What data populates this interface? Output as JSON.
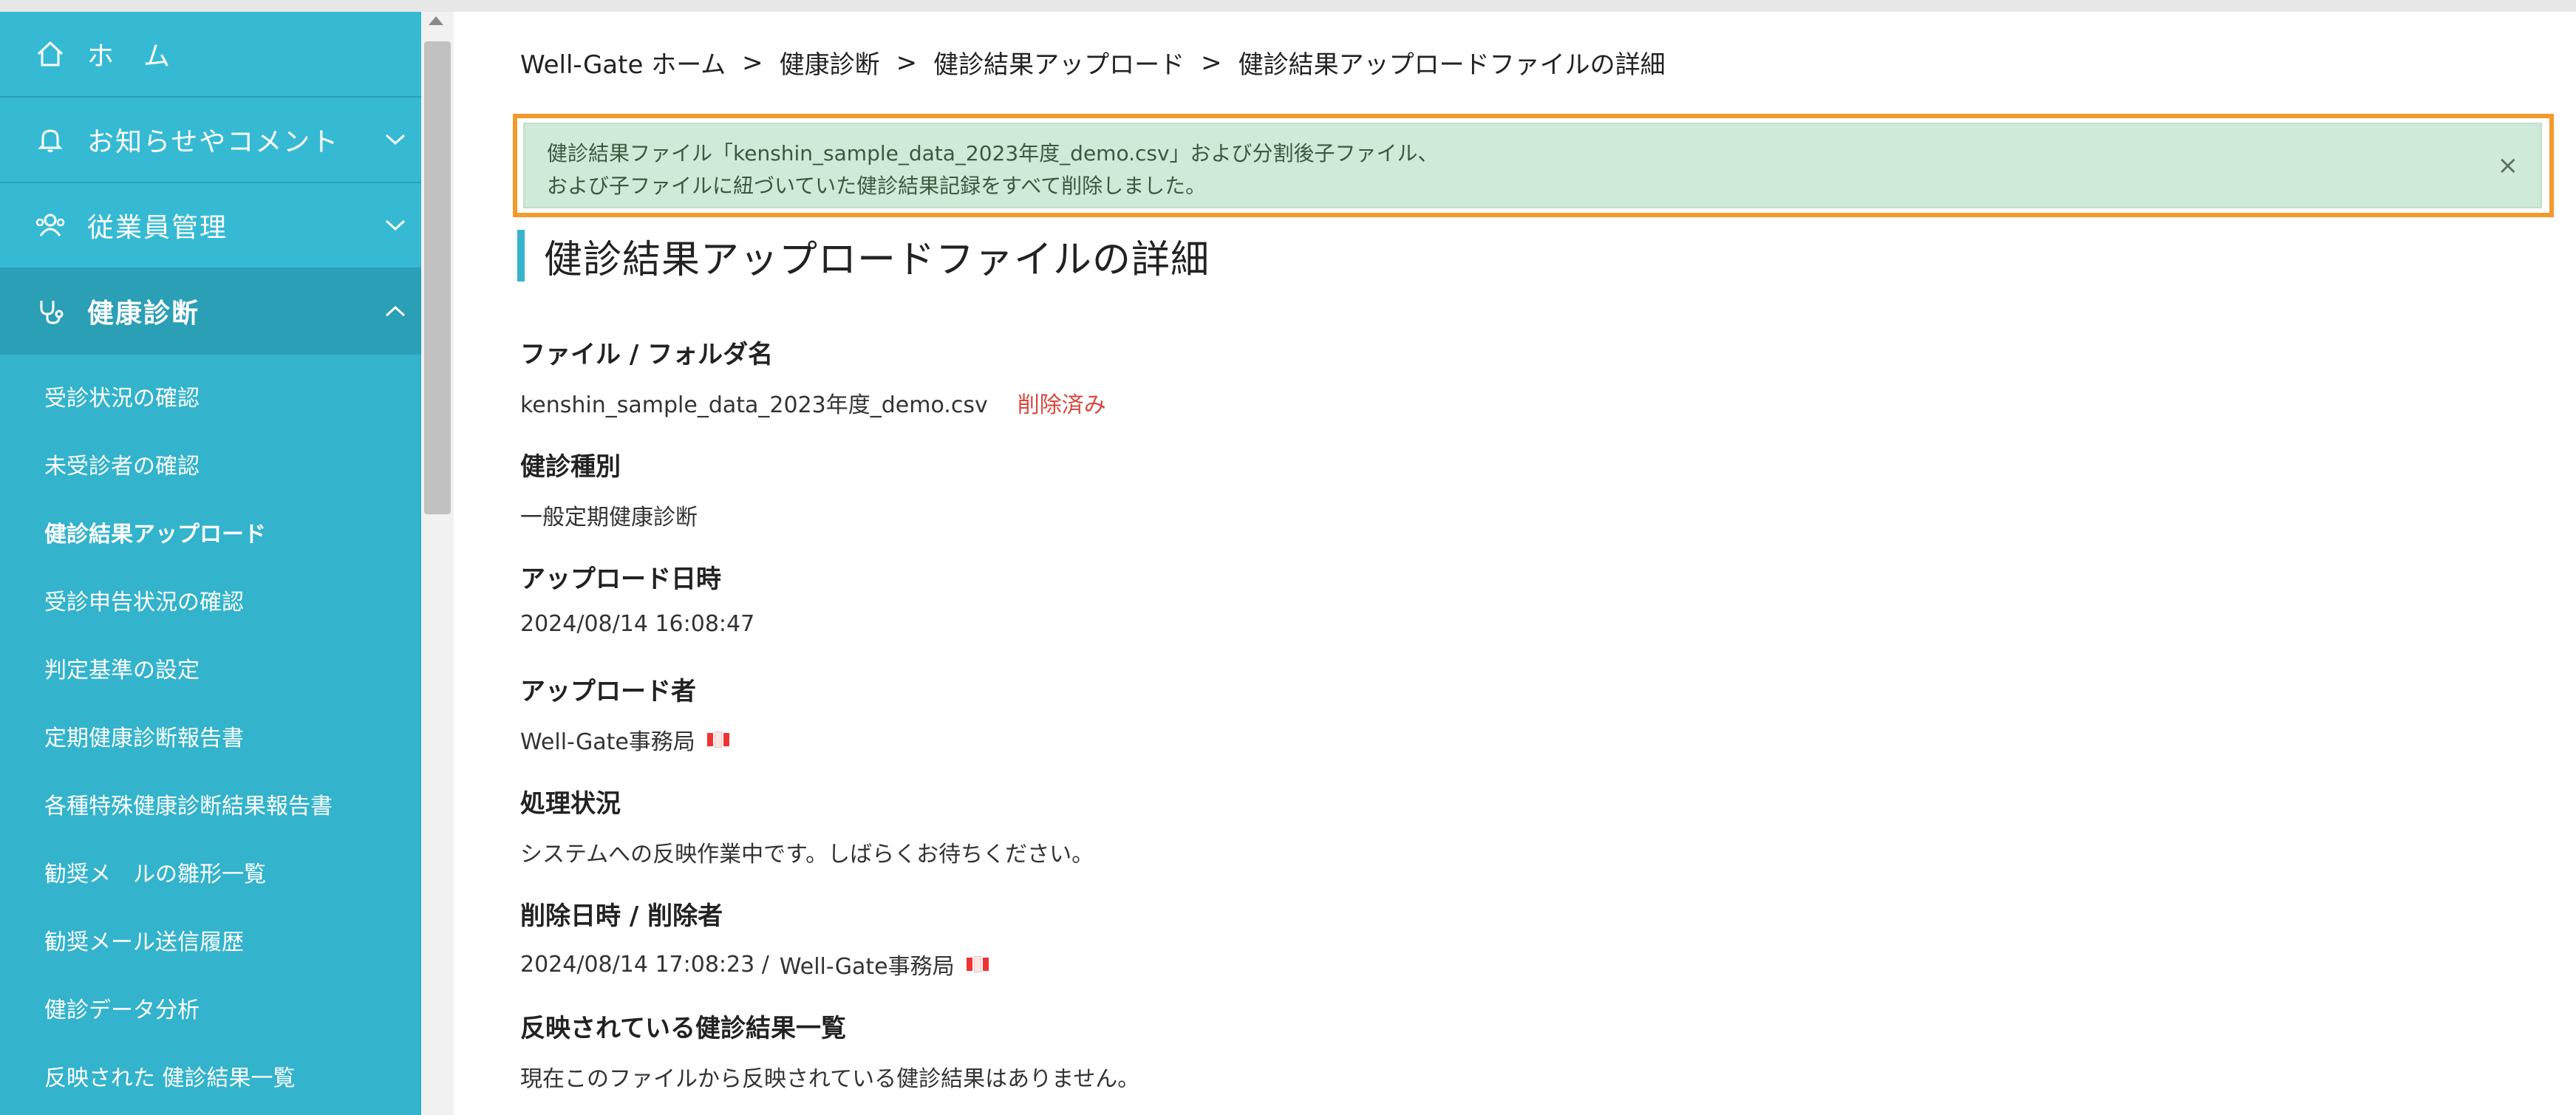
{
  "sidebar": {
    "top_items": [
      {
        "label": "ホ　ム",
        "icon": "home-icon"
      },
      {
        "label": "お知らせやコメント",
        "icon": "bell-icon"
      },
      {
        "label": "従業員管理",
        "icon": "users-icon"
      },
      {
        "label": "健康診断",
        "icon": "stethoscope-icon"
      }
    ],
    "sub_items": [
      "受診状況の確認",
      "未受診者の確認",
      "健診結果アップロード",
      "受診申告状況の確認",
      "判定基準の設定",
      "定期健康診断報告書",
      "各種特殊健康診断結果報告書",
      "勧奨メ　ルの雛形一覧",
      "勧奨メール送信履歴",
      "健診データ分析",
      "反映された 健診結果一覧"
    ],
    "current_sub_item": "健診結果アップロード"
  },
  "breadcrumb": [
    "Well-Gate ホーム",
    "健康診断",
    "健診結果アップロード",
    "健診結果アップロードファイルの詳細"
  ],
  "breadcrumb_separator": ">",
  "alert": {
    "line1": "健診結果ファイル「kenshin_sample_data_2023年度_demo.csv」および分割後子ファイル、",
    "line2": "および子ファイルに紐づいていた健診結果記録をすべて削除しました。",
    "close": "×"
  },
  "page_title": "健診結果アップロードファイルの詳細",
  "fields": {
    "file_name": {
      "label": "ファイル / フォルダ名",
      "value": "kenshin_sample_data_2023年度_demo.csv",
      "status": "削除済み"
    },
    "exam_type": {
      "label": "健診種別",
      "value": "一般定期健康診断"
    },
    "upload_datetime": {
      "label": "アップロード日時",
      "value": "2024/08/14 16:08:47"
    },
    "uploader": {
      "label": "アップロード者",
      "value": "Well-Gate事務局"
    },
    "processing_status": {
      "label": "処理状況",
      "value": "システムへの反映作業中です。しばらくお待ちください。"
    },
    "deletion": {
      "label": "削除日時 / 削除者",
      "datetime": "2024/08/14 17:08:23 /",
      "user": "Well-Gate事務局"
    },
    "reflected_results": {
      "label": "反映されている健診結果一覧",
      "value": "現在このファイルから反映されている健診結果はありません。"
    }
  },
  "colors": {
    "sidebar": "#33b3cc",
    "accent": "#36b4cd",
    "alert_bg": "#cfead8",
    "highlight_outline": "#f39a2b",
    "deleted": "#d9473e"
  }
}
